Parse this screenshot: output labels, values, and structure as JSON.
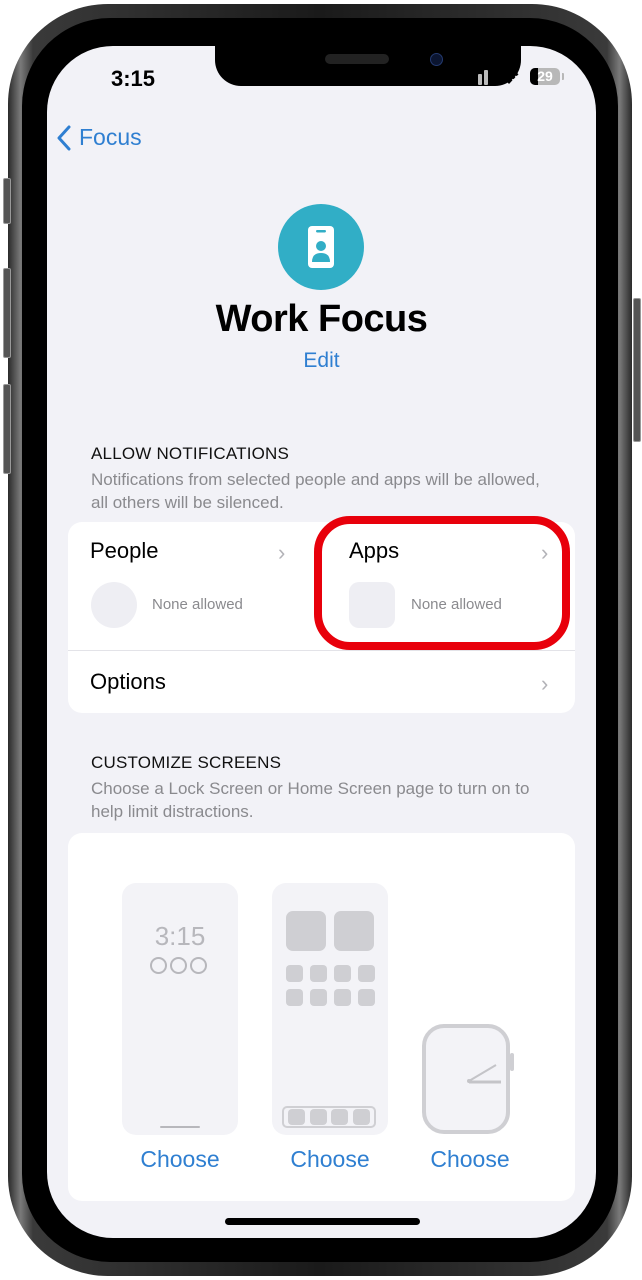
{
  "status_bar": {
    "time": "3:15",
    "battery_level": "29",
    "icons": [
      "cellular-signal-icon",
      "wifi-icon",
      "battery-icon"
    ]
  },
  "nav": {
    "back_label": "Focus",
    "back_icon": "chevron-left-icon"
  },
  "header": {
    "icon": "id-badge-icon",
    "title": "Work Focus",
    "edit_label": "Edit"
  },
  "allow_notifications": {
    "title": "ALLOW NOTIFICATIONS",
    "description": "Notifications from selected people and apps will be allowed, all others will be silenced.",
    "people": {
      "label": "People",
      "status": "None allowed"
    },
    "apps": {
      "label": "Apps",
      "status": "None allowed"
    },
    "options": {
      "label": "Options"
    }
  },
  "customize_screens": {
    "title": "CUSTOMIZE SCREENS",
    "description": "Choose a Lock Screen or Home Screen page to turn on to help limit distractions.",
    "lock_screen_preview_time": "3:15",
    "choices": [
      {
        "type": "lock-screen",
        "label": "Choose"
      },
      {
        "type": "home-screen",
        "label": "Choose"
      },
      {
        "type": "watch-face",
        "label": "Choose"
      }
    ]
  },
  "annotation": {
    "highlight_color": "#e8000b",
    "highlight_target": "apps-cell"
  },
  "colors": {
    "accent": "#2f7fd1",
    "focus_icon_bg": "#31aec6",
    "background": "#f2f2f7"
  }
}
